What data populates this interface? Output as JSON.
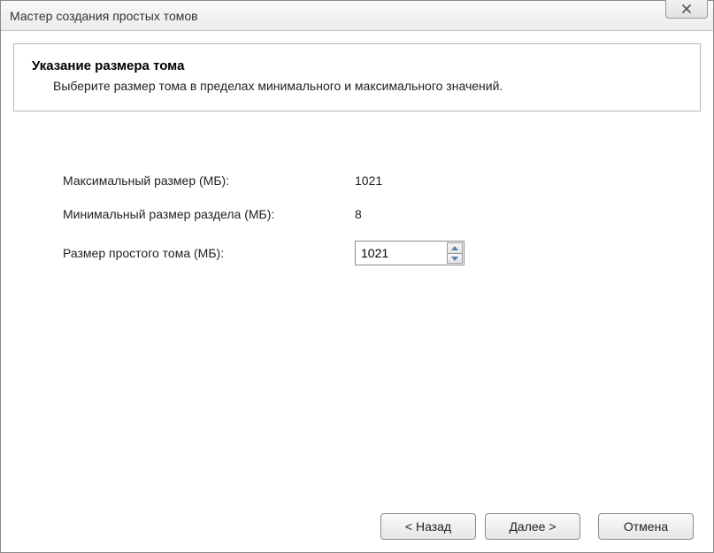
{
  "window": {
    "title": "Мастер создания простых томов"
  },
  "header": {
    "title": "Указание размера тома",
    "description": "Выберите размер тома в пределах минимального и максимального значений."
  },
  "form": {
    "max_label": "Максимальный размер (МБ):",
    "max_value": "1021",
    "min_label": "Минимальный размер раздела (МБ):",
    "min_value": "8",
    "size_label": "Размер простого тома (МБ):",
    "size_value": "1021"
  },
  "buttons": {
    "back": "< Назад",
    "next": "Далее >",
    "cancel": "Отмена"
  }
}
